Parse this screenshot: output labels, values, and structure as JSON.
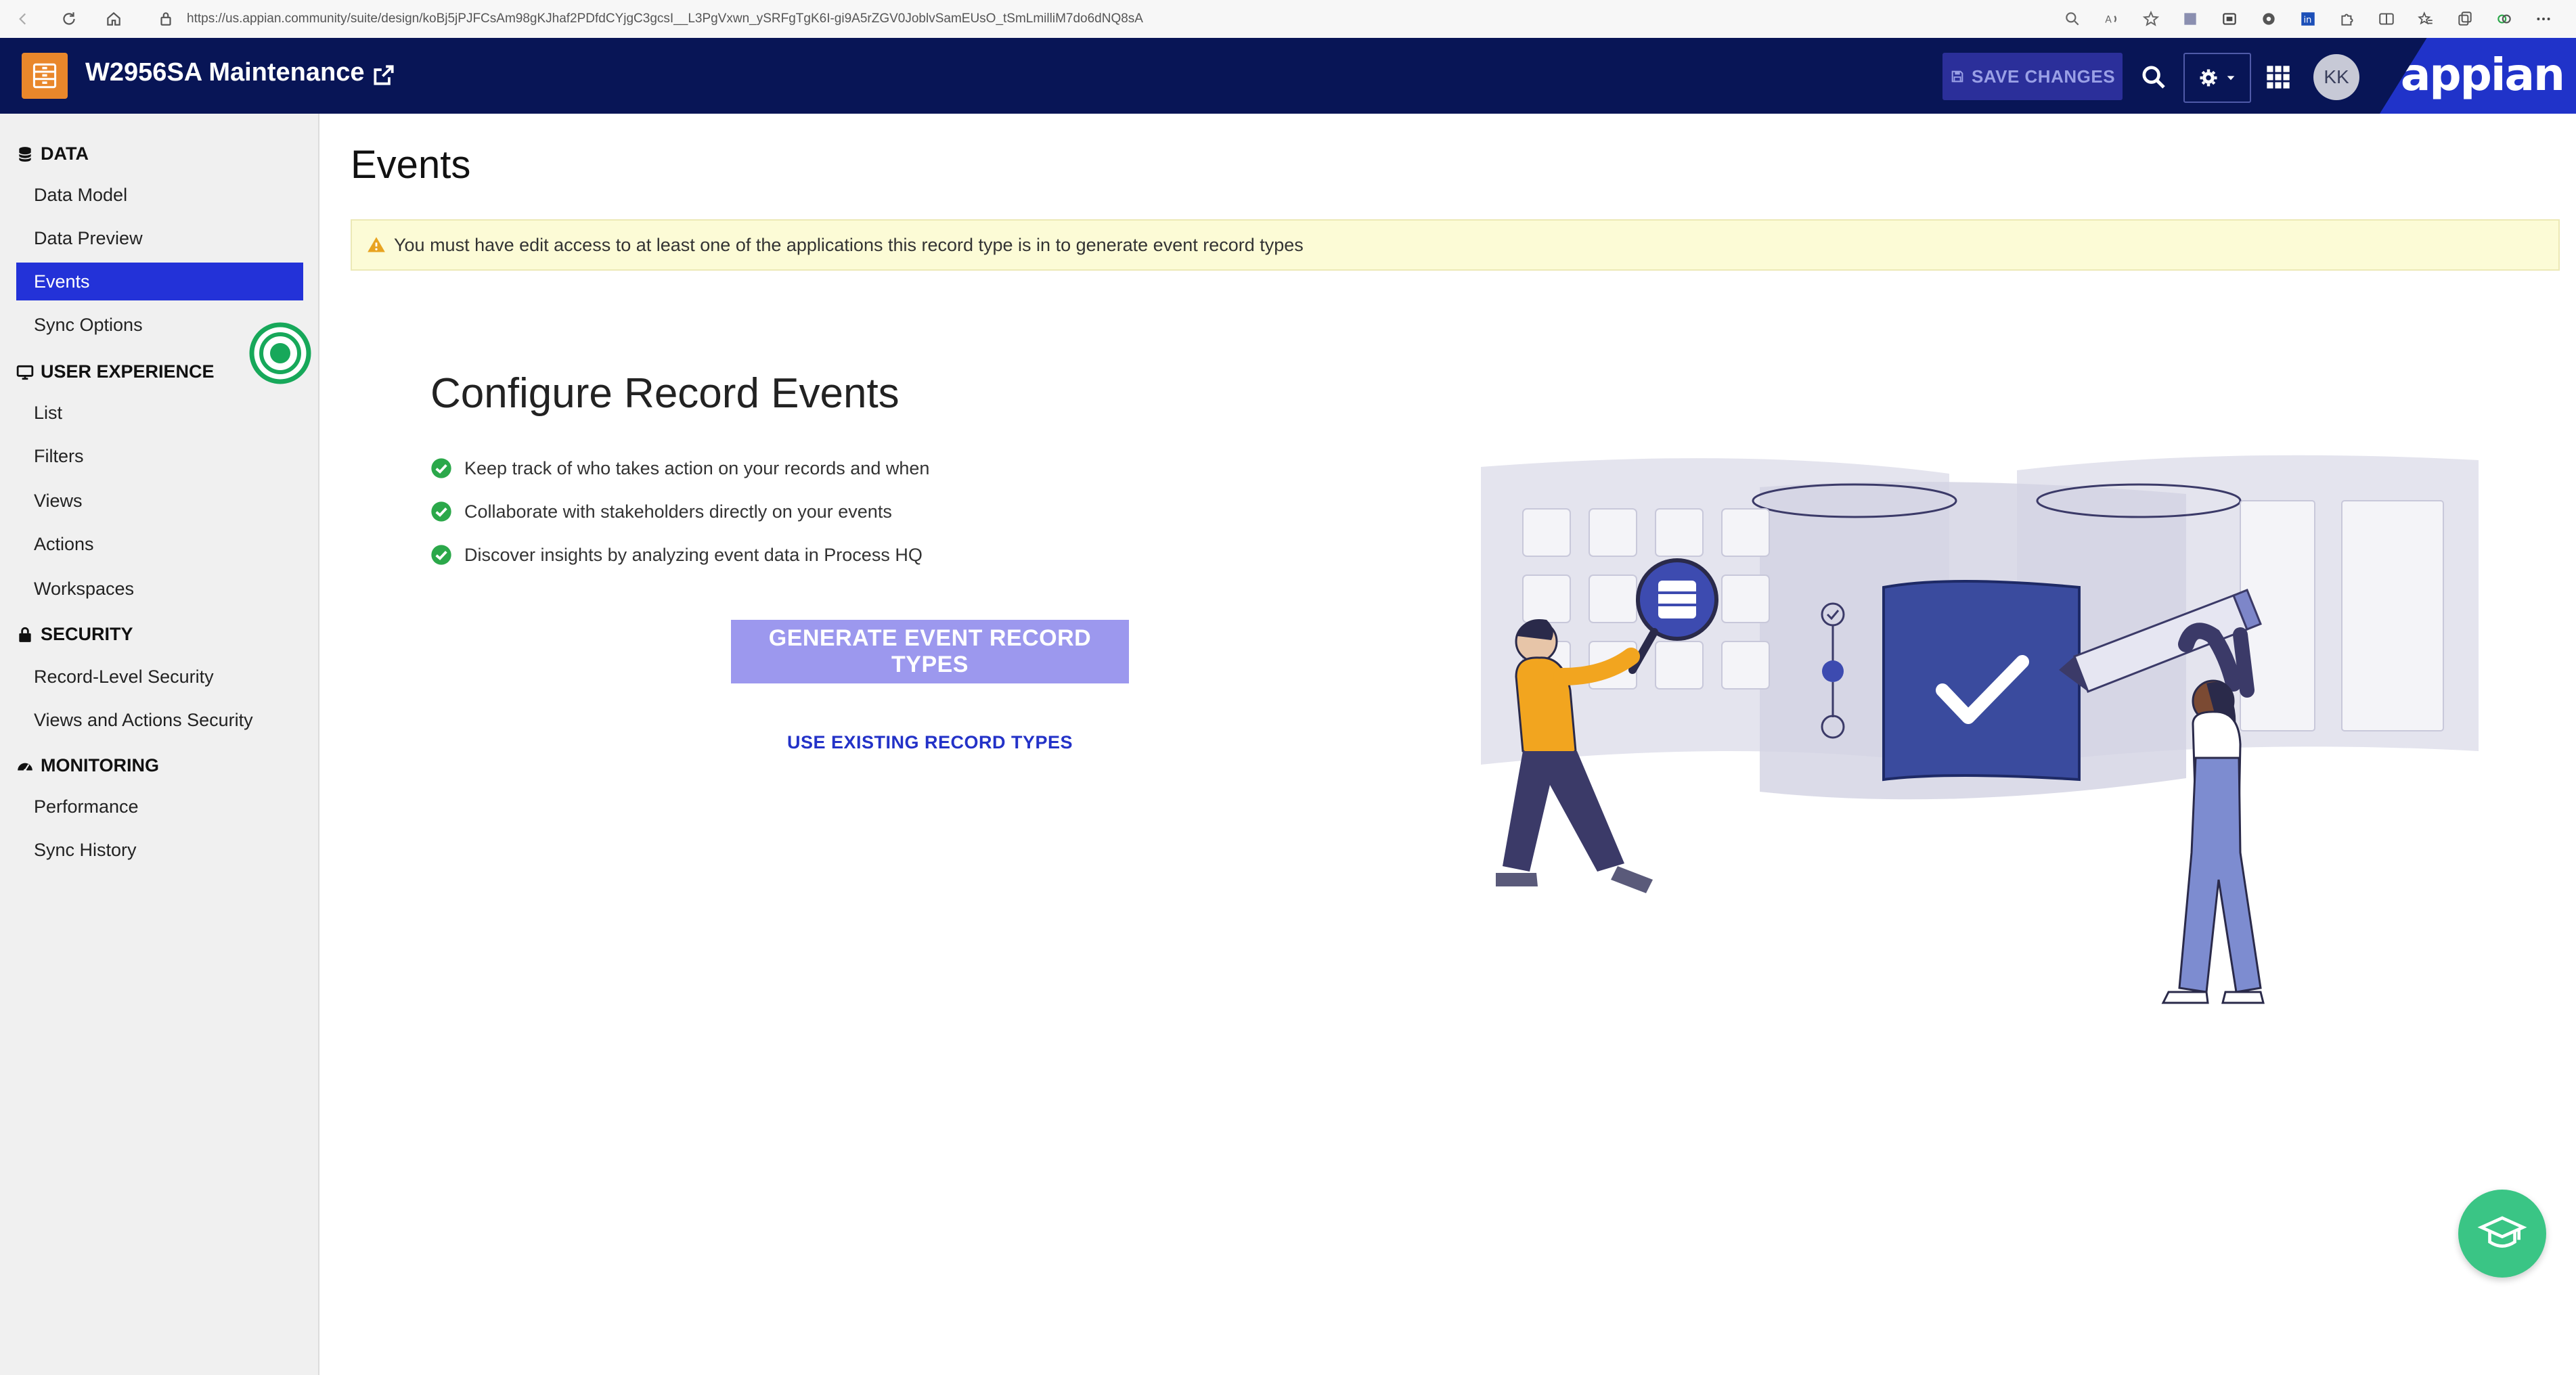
{
  "browser": {
    "url": "https://us.appian.community/suite/design/koBj5jPJFCsAm98gKJhaf2PDfdCYjgC3gcsI__L3PgVxwn_ySRFgTgK6I-gi9A5rZGV0JoblvSamEUsO_tSmLmilliM7do6dNQ8sA"
  },
  "header": {
    "app_title": "W2956SA Maintenance",
    "save_label": "SAVE CHANGES",
    "avatar_initials": "KK",
    "brand": "appian"
  },
  "sidebar": {
    "sections": [
      {
        "title": "DATA",
        "icon": "database-icon",
        "items": [
          {
            "label": "Data Model",
            "active": false
          },
          {
            "label": "Data Preview",
            "active": false
          },
          {
            "label": "Events",
            "active": true
          },
          {
            "label": "Sync Options",
            "active": false
          }
        ]
      },
      {
        "title": "USER EXPERIENCE",
        "icon": "monitor-icon",
        "items": [
          {
            "label": "List",
            "active": false
          },
          {
            "label": "Filters",
            "active": false
          },
          {
            "label": "Views",
            "active": false
          },
          {
            "label": "Actions",
            "active": false
          },
          {
            "label": "Workspaces",
            "active": false
          }
        ]
      },
      {
        "title": "SECURITY",
        "icon": "lock-icon",
        "items": [
          {
            "label": "Record-Level Security",
            "active": false
          },
          {
            "label": "Views and Actions Security",
            "active": false
          }
        ]
      },
      {
        "title": "MONITORING",
        "icon": "dashboard-icon",
        "items": [
          {
            "label": "Performance",
            "active": false
          },
          {
            "label": "Sync History",
            "active": false
          }
        ]
      }
    ]
  },
  "main": {
    "title": "Events",
    "warning": "You must have edit access to at least one of the applications this record type is in to generate event record types",
    "config_title": "Configure Record Events",
    "benefits": [
      "Keep track of who takes action on your records and when",
      "Collaborate with stakeholders directly on your events",
      "Discover insights by analyzing event data in Process HQ"
    ],
    "generate_label": "GENERATE EVENT RECORD TYPES",
    "use_existing_label": "USE EXISTING RECORD TYPES"
  },
  "colors": {
    "header_bg": "#081556",
    "accent": "#2332d8",
    "generate_button": "#9c98ee",
    "warning_bg": "#fcfbd6",
    "check_green": "#2ba84a",
    "help_button": "#3ac585"
  }
}
